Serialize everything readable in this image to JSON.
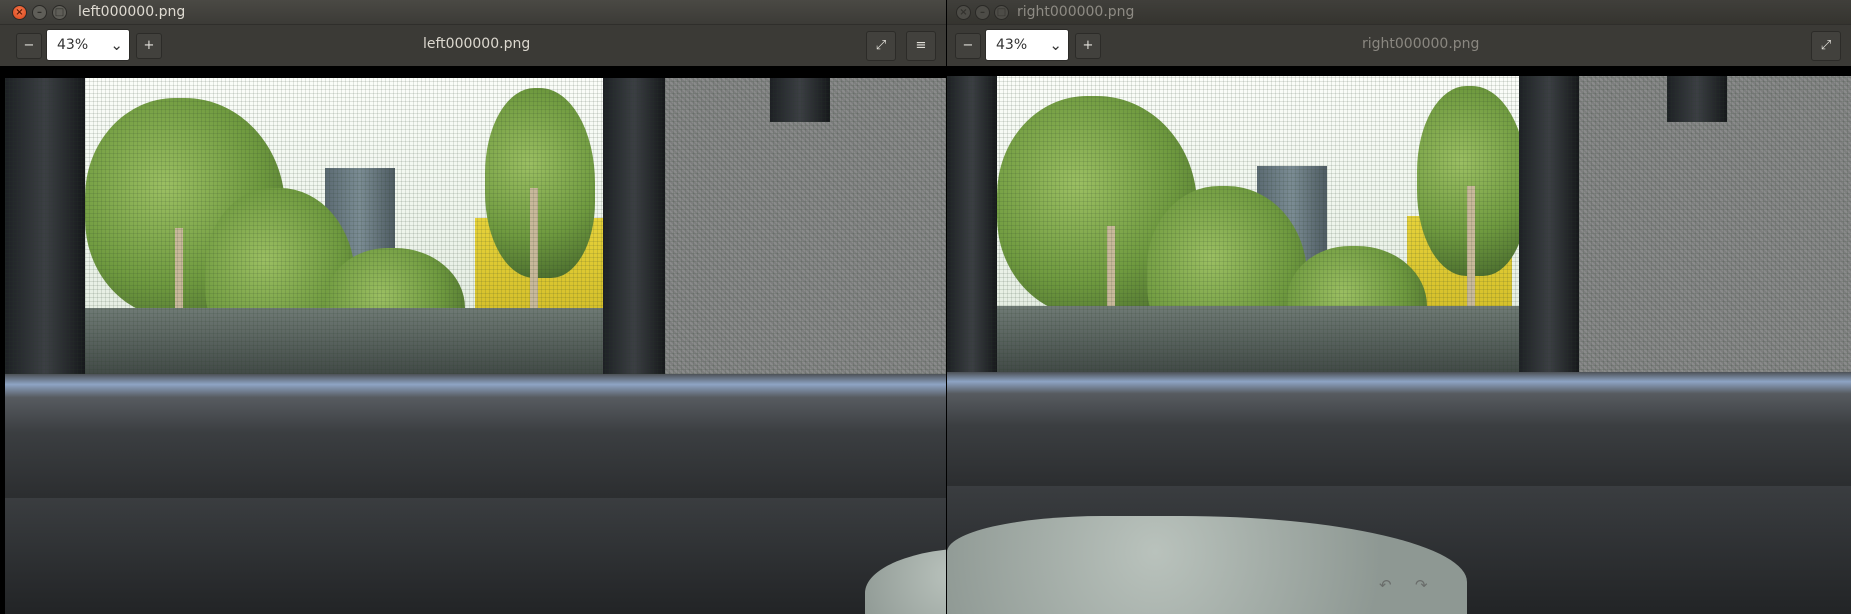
{
  "left_window": {
    "title": "left000000.png",
    "zoom": "43%",
    "filename": "left000000.png",
    "controls": {
      "close": "×",
      "minimize": "–",
      "maximize": "□"
    },
    "icons": {
      "zoom_out": "minus-icon",
      "zoom_in": "plus-icon",
      "fullscreen": "fullscreen-icon",
      "menu": "hamburger-menu-icon"
    }
  },
  "right_window": {
    "title": "right000000.png",
    "zoom": "43%",
    "filename": "right000000.png",
    "controls": {
      "close": "×",
      "minimize": "–",
      "maximize": "□"
    },
    "icons": {
      "zoom_out": "minus-icon",
      "zoom_in": "plus-icon",
      "fullscreen": "fullscreen-icon",
      "rotate_left": "rotate-left-icon",
      "rotate_right": "rotate-right-icon"
    }
  },
  "glyphs": {
    "minus": "−",
    "plus": "+",
    "chevron": "⌄",
    "fullscreen": "⤢",
    "menu": "≡",
    "rotate_left": "↶",
    "rotate_right": "↷"
  },
  "colors": {
    "close_button": "#e4572a",
    "titlebar": "#3c3b37",
    "toolbar": "#3b3a36"
  }
}
